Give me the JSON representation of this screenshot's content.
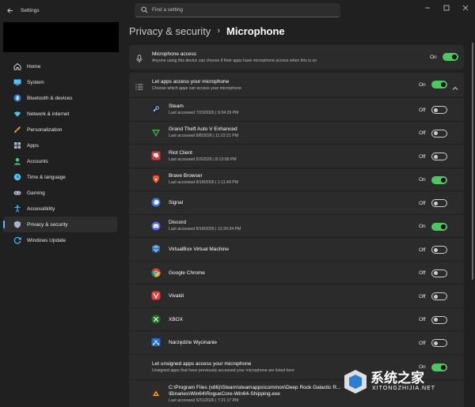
{
  "window": {
    "title": "Settings"
  },
  "search": {
    "placeholder": "Find a setting"
  },
  "sidebar": {
    "items": [
      {
        "label": "Home",
        "icon": "home-icon",
        "color": "#d9d9d9"
      },
      {
        "label": "System",
        "icon": "monitor-icon",
        "color": "#4cc2ff"
      },
      {
        "label": "Bluetooth & devices",
        "icon": "bluetooth-icon",
        "color": "#4cc2ff"
      },
      {
        "label": "Network & internet",
        "icon": "wifi-icon",
        "color": "#4cc2ff"
      },
      {
        "label": "Personalization",
        "icon": "brush-icon",
        "color": "#f1a152"
      },
      {
        "label": "Apps",
        "icon": "apps-icon",
        "color": "#a7b4c9"
      },
      {
        "label": "Accounts",
        "icon": "person-icon",
        "color": "#3fd28f"
      },
      {
        "label": "Time & language",
        "icon": "clock-icon",
        "color": "#4cc2ff"
      },
      {
        "label": "Gaming",
        "icon": "gamepad-icon",
        "color": "#a7b4c9"
      },
      {
        "label": "Accessibility",
        "icon": "accessibility-icon",
        "color": "#4cc2ff"
      },
      {
        "label": "Privacy & security",
        "icon": "shield-icon",
        "color": "#a7b4c9",
        "active": true
      },
      {
        "label": "Windows Update",
        "icon": "update-icon",
        "color": "#4cc2ff"
      }
    ]
  },
  "breadcrumb": {
    "parent": "Privacy & security",
    "separator": "›",
    "current": "Microphone"
  },
  "mic_access": {
    "title": "Microphone access",
    "description": "Anyone using this device can choose if their apps have microphone access when this is on",
    "state": "On"
  },
  "let_apps": {
    "title": "Let apps access your microphone",
    "description": "Choose which apps can access your microphone",
    "state": "On"
  },
  "apps": [
    {
      "name": "Steam",
      "access": "Last accessed 7/23/2026 | 9:34:29 PM",
      "state": "Off",
      "icon": "steam-icon"
    },
    {
      "name": "Grand Theft Auto V Enhanced",
      "access": "Last accessed 8/8/2026 | 11:22:21 PM",
      "state": "Off",
      "icon": "gta-icon"
    },
    {
      "name": "Riot Client",
      "access": "Last accessed 5/3/2026 | 8:13:58 PM",
      "state": "Off",
      "icon": "riot-icon"
    },
    {
      "name": "Brave Browser",
      "access": "Last accessed 8/18/2026 | 1:11:49 PM",
      "state": "On",
      "icon": "brave-icon"
    },
    {
      "name": "Signal",
      "access": "",
      "state": "Off",
      "icon": "signal-icon"
    },
    {
      "name": "Discord",
      "access": "Last accessed 8/18/2026 | 12:20:34 PM",
      "state": "On",
      "icon": "discord-icon"
    },
    {
      "name": "VirtualBox Virtual Machine",
      "access": "",
      "state": "Off",
      "icon": "virtualbox-icon"
    },
    {
      "name": "Google Chrome",
      "access": "",
      "state": "Off",
      "icon": "chrome-icon"
    },
    {
      "name": "Vivaldi",
      "access": "",
      "state": "Off",
      "icon": "vivaldi-icon"
    },
    {
      "name": "XBOX",
      "access": "",
      "state": "Off",
      "icon": "xbox-icon"
    },
    {
      "name": "Narzędzie Wycinanie",
      "access": "",
      "state": "Off",
      "icon": "snipping-tool-icon"
    }
  ],
  "unsigned": {
    "title": "Let unsigned apps access your microphone",
    "description": "Unsigned apps that have previously accessed your microphone are listed here",
    "state": "On"
  },
  "unsigned_app": {
    "path_line1": "C:\\Program Files (x86)\\Steam\\steamapps\\common\\Deep Rock Galactic R...",
    "path_line2": "\\Binaries\\Win64\\RogueCore-Win64-Shipping.exe",
    "access": "Last accessed 5/31/2026 | 7:21:17 PM"
  },
  "watermark": {
    "text": "系统之家",
    "sub": "XITONGZHIJIA.NET"
  },
  "colors": {
    "accent": "#4cc2ff",
    "toggle_on": "#4cc95c",
    "card": "#2b2b2b",
    "background": "#202020"
  }
}
